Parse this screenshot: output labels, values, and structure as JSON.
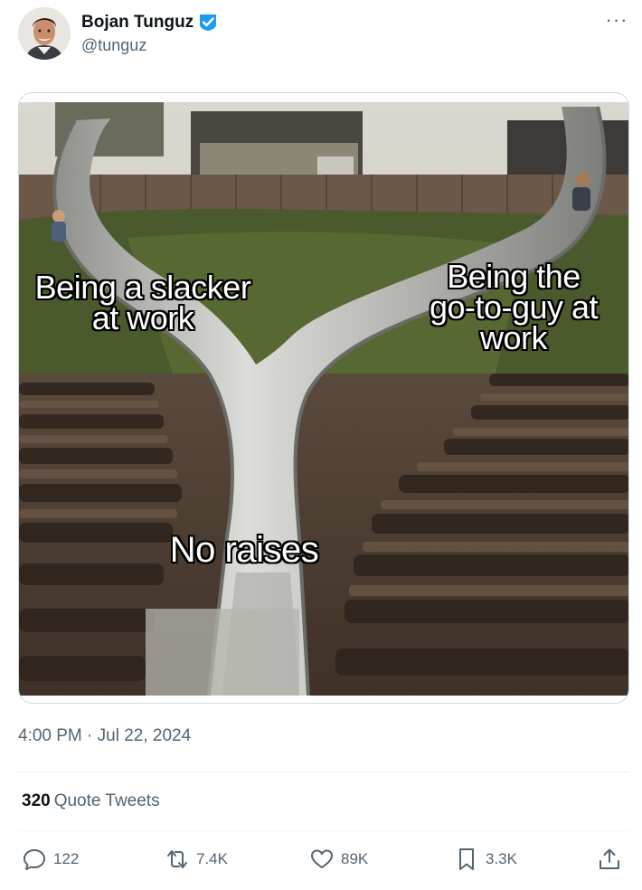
{
  "tweet": {
    "author_name": "Bojan Tunguz",
    "author_handle": "@tunguz",
    "more_label": "···",
    "timestamp": "4:00 PM · Jul 22, 2024"
  },
  "meme": {
    "left_text": "Being a slacker at work",
    "right_text": "Being the go-to-guy at work",
    "bottom_text": "No raises"
  },
  "stats": {
    "quote_count": "320",
    "quote_label": "Quote Tweets"
  },
  "actions": {
    "replies": "122",
    "retweets": "7.4K",
    "likes": "89K",
    "bookmarks": "3.3K"
  },
  "colors": {
    "verified": "#1d9bf0",
    "secondary_text": "#536471",
    "primary_text": "#0f1419",
    "border": "#cfd9de"
  }
}
